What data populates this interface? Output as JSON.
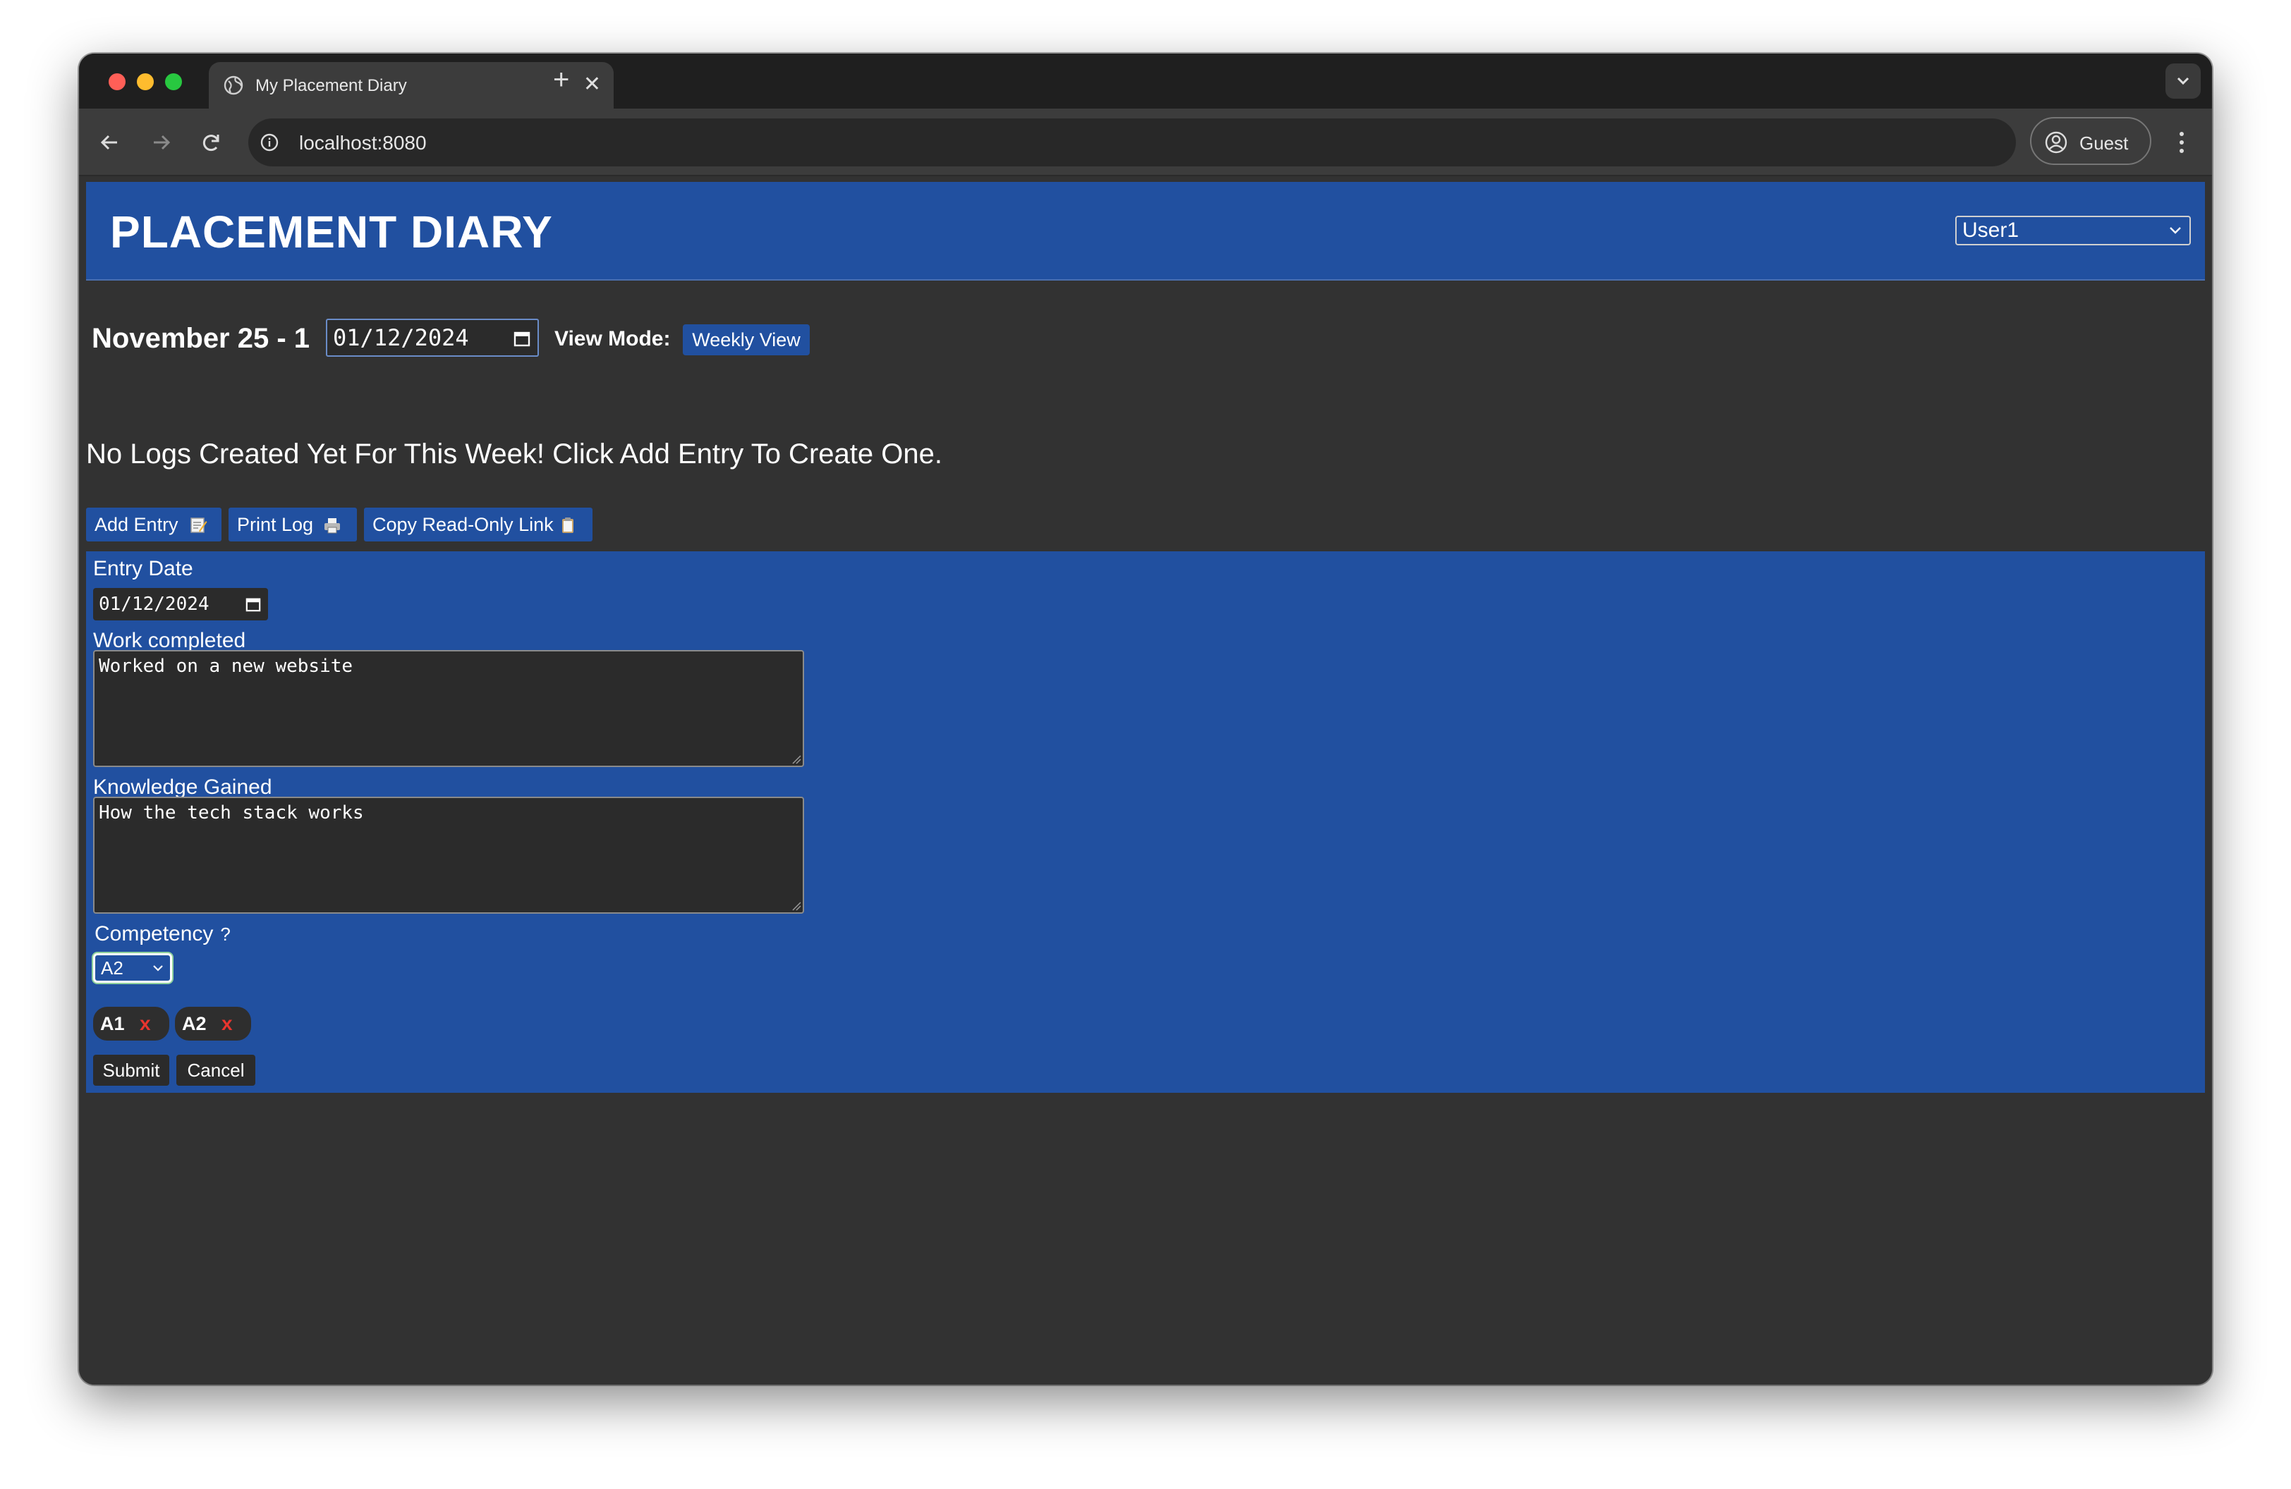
{
  "browser": {
    "tab_title": "My Placement Diary",
    "url": "localhost:8080",
    "profile_label": "Guest"
  },
  "header": {
    "brand": "PLACEMENT DIARY",
    "user_selected": "User1"
  },
  "week": {
    "label": "November 25 - 1",
    "date_value": "01/12/2024",
    "view_mode_label": "View Mode:",
    "view_mode_button": "Weekly View"
  },
  "message": "No Logs Created Yet For This Week! Click Add Entry To Create One.",
  "actions": {
    "add_entry": "Add Entry",
    "print_log": "Print Log",
    "copy_link": "Copy Read-Only Link"
  },
  "form": {
    "entry_date_label": "Entry Date",
    "entry_date_value": "01/12/2024",
    "work_label": "Work completed",
    "work_value": "Worked on a new website",
    "knowledge_label": "Knowledge Gained",
    "knowledge_value": "How the tech stack works",
    "competency_label": "Competency",
    "competency_help": "?",
    "competency_selected": "A2",
    "chips": [
      {
        "label": "A1",
        "remove": "x"
      },
      {
        "label": "A2",
        "remove": "x"
      }
    ],
    "submit": "Submit",
    "cancel": "Cancel"
  },
  "colors": {
    "accent_blue": "#2150a0",
    "page_bg": "#323232",
    "chip_remove": "#e8352e"
  },
  "icons": [
    "globe-icon",
    "close-icon",
    "plus-icon",
    "back-arrow-icon",
    "forward-arrow-icon",
    "reload-icon",
    "info-icon",
    "account-icon",
    "kebab-menu-icon",
    "calendar-icon",
    "memo-icon",
    "printer-icon",
    "clipboard-icon",
    "chevron-down-icon"
  ]
}
